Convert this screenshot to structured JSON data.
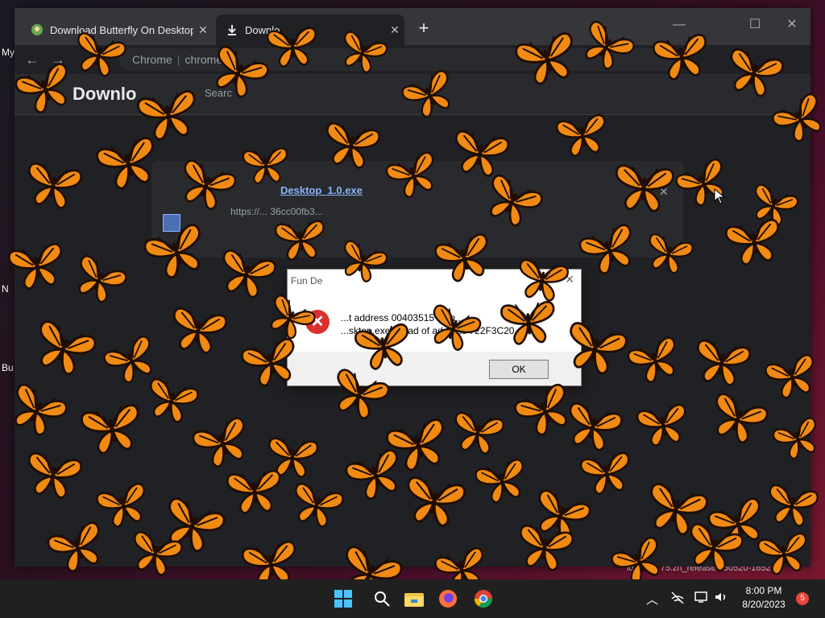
{
  "desktop": {
    "icon_labels": [
      "My",
      "N",
      "Bu"
    ],
    "build_text": "ion co... 75.zn_release.230520-1652"
  },
  "browser": {
    "tabs": [
      {
        "title": "Download Butterfly On Desktop",
        "favicon": "butterfly-site-icon",
        "active": false
      },
      {
        "title": "Downlo",
        "favicon": "download-icon",
        "active": true
      }
    ],
    "new_tab_label": "+",
    "window_controls": {
      "minimize": "—",
      "maximize": "☐",
      "close": "✕"
    },
    "omnibox": {
      "origin": "Chrome",
      "url": "chrome://"
    }
  },
  "downloads_page": {
    "title": "Downlo",
    "search_placeholder": "Searc",
    "item": {
      "filename": "Desktop_1.0.exe",
      "url": "https://... 36cc00fb3...",
      "remove_label": "✕"
    }
  },
  "error_dialog": {
    "title": "Fun De",
    "close_label": "✕",
    "icon": "error-icon",
    "line1": "...t address 00403515 in m...",
    "line2": "...sktop.exe. Read of address 722F3C20",
    "ok_label": "OK"
  },
  "taskbar": {
    "time": "8:00 PM",
    "date": "8/20/2023",
    "notification_count": "5",
    "pinned": [
      "windows-start-icon",
      "search-icon",
      "file-explorer-icon",
      "firefox-icon",
      "chrome-icon"
    ],
    "tray": [
      "chevron-up-icon",
      "network-offline-icon",
      "display-icon",
      "speaker-icon"
    ]
  },
  "colors": {
    "butterfly_orange": "#f08a12",
    "butterfly_vein": "#1e0d04",
    "taskbar": "#202020",
    "browser_bg": "#202124",
    "link": "#8ab4f8"
  }
}
